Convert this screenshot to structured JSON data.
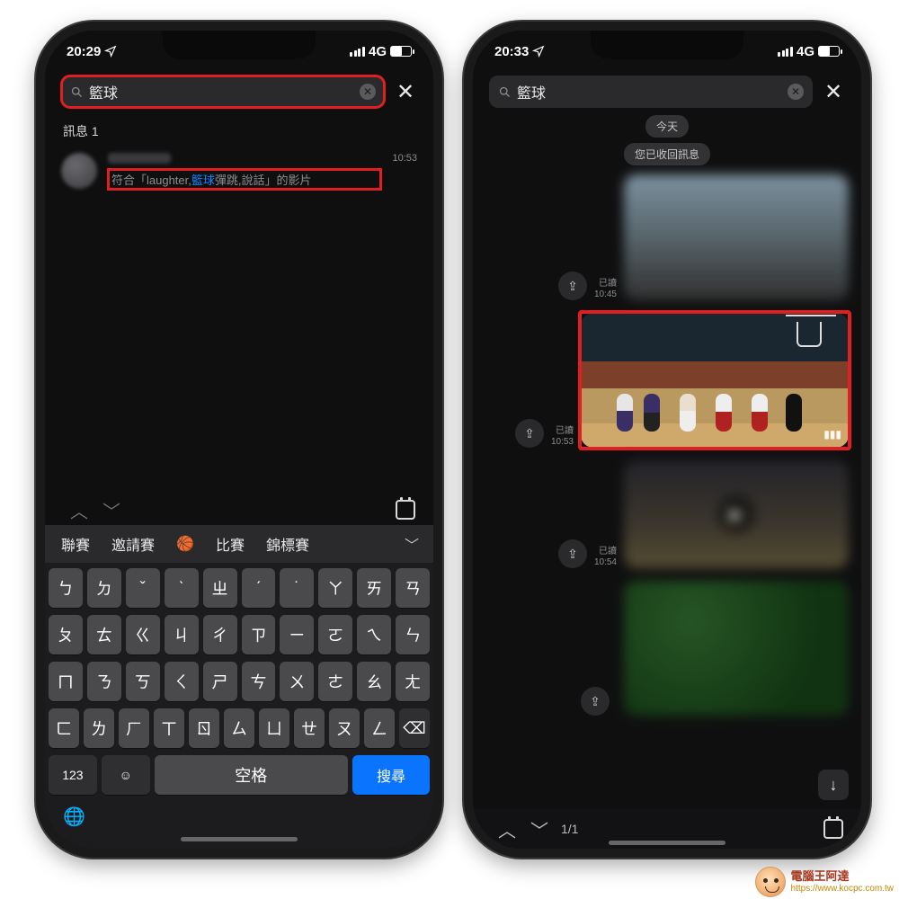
{
  "left": {
    "status": {
      "time": "20:29",
      "net": "4G"
    },
    "search": {
      "value": "籃球"
    },
    "section_label": "訊息 1",
    "message": {
      "time": "10:53",
      "prefix": "符合「laughter,",
      "keyword": "籃球",
      "suffix": "彈跳,說話」的影片"
    },
    "suggestions": [
      "聯賽",
      "邀請賽",
      "🏀",
      "比賽",
      "錦標賽"
    ],
    "keyboard": {
      "rows": [
        [
          "ㄅ",
          "ㄉ",
          "ˇ",
          "ˋ",
          "ㄓ",
          "ˊ",
          "˙",
          "ㄚ",
          "ㄞ",
          "ㄢ"
        ],
        [
          "ㄆ",
          "ㄊ",
          "ㄍ",
          "ㄐ",
          "ㄔ",
          "ㄗ",
          "ㄧ",
          "ㄛ",
          "ㄟ",
          "ㄣ"
        ],
        [
          "ㄇ",
          "ㄋ",
          "ㄎ",
          "ㄑ",
          "ㄕ",
          "ㄘ",
          "ㄨ",
          "ㄜ",
          "ㄠ",
          "ㄤ"
        ],
        [
          "ㄈ",
          "ㄌ",
          "ㄏ",
          "ㄒ",
          "ㄖ",
          "ㄙ",
          "ㄩ",
          "ㄝ",
          "ㄡ",
          "ㄥ"
        ]
      ],
      "num_key": "123",
      "space": "空格",
      "search": "搜尋"
    }
  },
  "right": {
    "status": {
      "time": "20:33",
      "net": "4G"
    },
    "search": {
      "value": "籃球"
    },
    "date_pill": "今天",
    "recall_pill": "您已收回訊息",
    "read_label": "已讀",
    "times": {
      "t1": "10:45",
      "t2": "10:53",
      "t3": "10:54"
    },
    "result_count": "1/1"
  },
  "watermark": {
    "title": "電腦王阿達",
    "url": "https://www.kocpc.com.tw"
  }
}
